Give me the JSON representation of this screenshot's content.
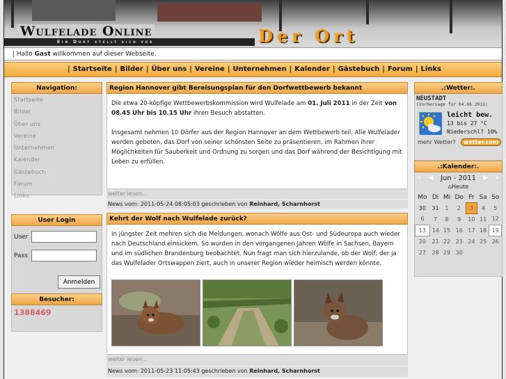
{
  "header": {
    "logo_main": "Wulfelade Online",
    "logo_tagline": "Ein Dorf stellt sich vor",
    "logo_secondary": "Der Ort"
  },
  "greeting": {
    "prefix": "| Hallo ",
    "user": "Gast",
    "suffix": " willkommen auf dieser Webseite."
  },
  "topnav": [
    "Startseite",
    "Bilder",
    "Über uns",
    "Vereine",
    "Unternehmen",
    "Kalender",
    "Gästebuch",
    "Forum",
    "Links"
  ],
  "navigation": {
    "title": "Navigation:",
    "items": [
      "Startseite",
      "Bilder",
      "Über uns",
      "Vereine",
      "Unternehmen",
      "Kalender",
      "Gästebuch",
      "Forum",
      "Links"
    ]
  },
  "login": {
    "title": "User Login",
    "user_label": "User",
    "pass_label": "Pass",
    "button": "Anmelden"
  },
  "visitors": {
    "title": "Besucher:",
    "count": "1388469"
  },
  "articles": [
    {
      "title": "Region Hannover gibt Bereisungsplan für den Dorfwettbewerb bekannt",
      "p1_a": "Die etwa 20-köpfige Wettbewerbskommission wird Wulfelade am ",
      "p1_b": "01. Juli 2011",
      "p1_c": " in der Zeit ",
      "p1_d": "von 08.45 Uhr bis 10.15 Uhr",
      "p1_e": " ihren Besuch abstatten.",
      "p2": "Insgesamt nehmen 10 Dörfer aus der Region Hannover an dem Wettbewerb teil. Alle Wulfelader werden gebeten, das Dorf von seiner schönsten Seite zu präsentieren, im Rahmen ihrer Möglichkeiten für Sauberkeit und Ordnung zu sorgen und das Dorf während der Besichtigung mit Leben zu erfüllen.",
      "more": "weiter lesen...",
      "news_prefix": "News vom: 2011-05-24 08:05:03 geschrieben von ",
      "author": "Reinhard, Scharnhorst"
    },
    {
      "title": "Kehrt der Wolf nach Wulfelade zurück?",
      "p1": "In jüngster Zeit mehren sich die Meldungen, wonach Wölfe aus Ost- und Südeuropa auch wieder nach Deutschland einsickern. So wurden in den vergangenen Jahren Wölfe in Sachsen, Bayern und im südlichen Brandenburg beobachtet. Nun fragt man sich hierzulande, ob der Wolf, der ja das Wulfelader Ortswappen ziert, auch in unserer Region wieder heimisch werden könnte.",
      "more": "weiter lesen...",
      "news_prefix": "News vom: 2011-05-23 11:05:43 geschrieben von ",
      "author": "Reinhard, Scharnhorst"
    }
  ],
  "weather": {
    "title": ".:Wetter:.",
    "city": "NEUSTADT",
    "subtitle": "(Vorhersage für 04.06.2011)",
    "condition": "leicht bew.",
    "temp": "13 bis 27 °C",
    "rain": "Niederschl? 10%",
    "more": "mehr Wetter?",
    "logo": "wetter.com"
  },
  "calendar": {
    "title": ".:Kalender:.",
    "month": "Jun - 2011",
    "today": "Heute",
    "weekdays": [
      "Mo",
      "Di",
      "Mi",
      "Do",
      "Fr",
      "Sa",
      "So"
    ],
    "weeks": [
      [
        "30",
        "31",
        "1",
        "2",
        "3",
        "4",
        "5"
      ],
      [
        "6",
        "7",
        "8",
        "9",
        "10",
        "11",
        "12"
      ],
      [
        "13",
        "14",
        "15",
        "16",
        "17",
        "18",
        "19"
      ],
      [
        "20",
        "21",
        "22",
        "23",
        "24",
        "25",
        "26"
      ],
      [
        "27",
        "28",
        "29",
        "30",
        "",
        "",
        ""
      ]
    ]
  }
}
